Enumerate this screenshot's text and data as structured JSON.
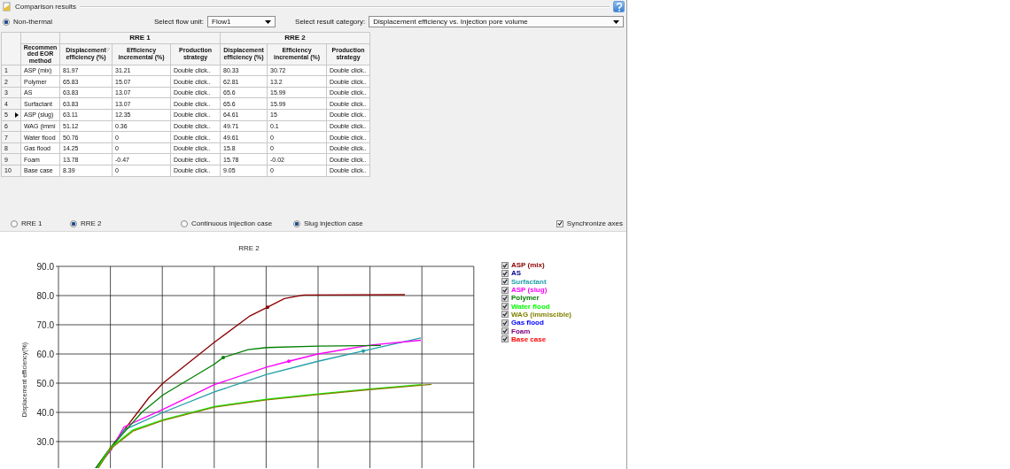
{
  "panel": {
    "title": "Comparison results"
  },
  "mode": {
    "label": "Non-thermal",
    "selected": true
  },
  "flow_unit": {
    "label": "Select flow unit:",
    "value": "Flow1"
  },
  "result_category": {
    "label": "Select result category:",
    "value": "Displacement efficiency vs. Injection pore volume"
  },
  "table": {
    "groups": [
      "RRE 1",
      "RRE 2"
    ],
    "columns": [
      {
        "label": "Recommended EOR method",
        "sorted": false
      },
      {
        "label": "Displacement efficiency (%)",
        "sorted": true
      },
      {
        "label": "Efficiency incremental (%)",
        "sorted": false
      },
      {
        "label": "Production strategy",
        "sorted": false
      },
      {
        "label": "Displacement efficiency (%)",
        "sorted": false
      },
      {
        "label": "Efficiency incremental (%)",
        "sorted": false
      },
      {
        "label": "Production strategy",
        "sorted": false
      }
    ],
    "rows": [
      {
        "index": "1",
        "current": false,
        "cells": [
          "ASP (mix)",
          "81.97",
          "31.21",
          "Double click..",
          "80.33",
          "30.72",
          "Double click.."
        ]
      },
      {
        "index": "2",
        "current": false,
        "cells": [
          "Polymer",
          "65.83",
          "15.07",
          "Double click..",
          "62.81",
          "13.2",
          "Double click.."
        ]
      },
      {
        "index": "3",
        "current": false,
        "cells": [
          "AS",
          "63.83",
          "13.07",
          "Double click..",
          "65.6",
          "15.99",
          "Double click.."
        ]
      },
      {
        "index": "4",
        "current": false,
        "cells": [
          "Surfactant",
          "63.83",
          "13.07",
          "Double click..",
          "65.6",
          "15.99",
          "Double click.."
        ]
      },
      {
        "index": "5",
        "current": true,
        "cells": [
          "ASP (slug)",
          "63.11",
          "12.35",
          "Double click..",
          "64.61",
          "15",
          "Double click.."
        ]
      },
      {
        "index": "6",
        "current": false,
        "cells": [
          "WAG (immi",
          "51.12",
          "0.36",
          "Double click..",
          "49.71",
          "0.1",
          "Double click.."
        ]
      },
      {
        "index": "7",
        "current": false,
        "cells": [
          "Water flood",
          "50.76",
          "0",
          "Double click..",
          "49.61",
          "0",
          "Double click.."
        ]
      },
      {
        "index": "8",
        "current": false,
        "cells": [
          "Gas flood",
          "14.25",
          "0",
          "Double click..",
          "15.8",
          "0",
          "Double click.."
        ]
      },
      {
        "index": "9",
        "current": false,
        "cells": [
          "Foam",
          "13.78",
          "-0.47",
          "Double click..",
          "15.78",
          "-0.02",
          "Double click.."
        ]
      },
      {
        "index": "10",
        "current": false,
        "cells": [
          "Base case",
          "8.39",
          "0",
          "Double click..",
          "9.05",
          "0",
          "Double click.."
        ]
      }
    ]
  },
  "case_options": [
    {
      "label": "RRE 1",
      "selected": false
    },
    {
      "label": "RRE 2",
      "selected": true
    }
  ],
  "injection_options": [
    {
      "label": "Continuous injection case",
      "selected": false
    },
    {
      "label": "Slug injection case",
      "selected": true
    }
  ],
  "synchronize_axes": {
    "label": "Synchronize axes",
    "checked": true
  },
  "chart": {
    "title": "RRE 2",
    "ylabel": "Displacement efficiency(%)",
    "yticks": [
      "90.0",
      "80.0",
      "70.0",
      "60.0",
      "50.0",
      "40.0",
      "30.0"
    ],
    "legend": [
      {
        "label": "ASP (mix)",
        "color": "#8b0000",
        "checked": true
      },
      {
        "label": "AS",
        "color": "#00008b",
        "checked": true
      },
      {
        "label": "Surfactant",
        "color": "#20a0a8",
        "checked": true
      },
      {
        "label": "ASP (slug)",
        "color": "#ff00ff",
        "checked": true
      },
      {
        "label": "Polymer",
        "color": "#008000",
        "checked": true
      },
      {
        "label": "Water flood",
        "color": "#00ff00",
        "checked": true
      },
      {
        "label": "WAG (immiscible)",
        "color": "#808000",
        "checked": true
      },
      {
        "label": "Gas flood",
        "color": "#0000ff",
        "checked": true
      },
      {
        "label": "Foam",
        "color": "#800080",
        "checked": true
      },
      {
        "label": "Base case",
        "color": "#ff0000",
        "checked": true
      }
    ]
  }
}
